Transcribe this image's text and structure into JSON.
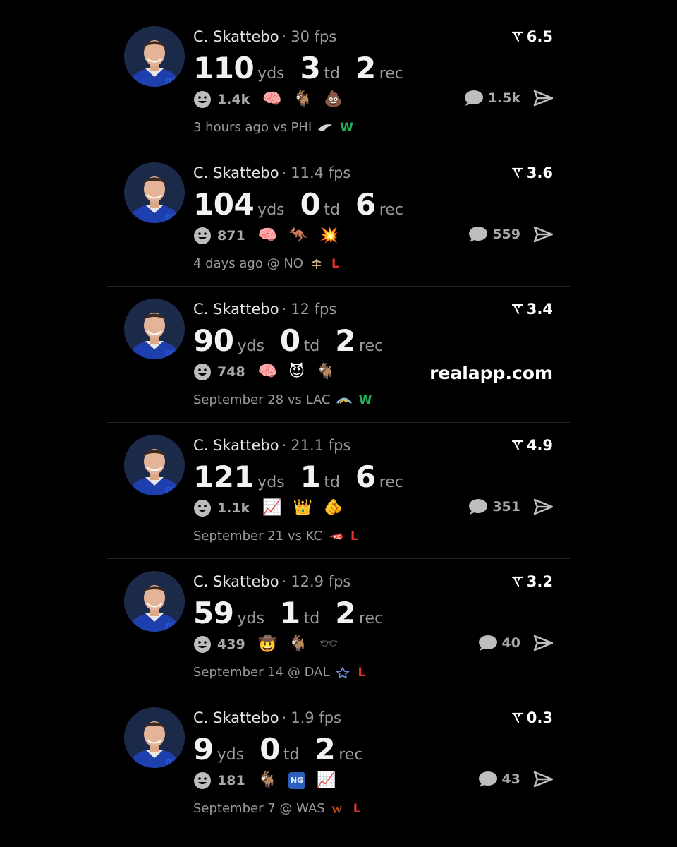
{
  "posts": [
    {
      "name": "C. Skattebo",
      "separator": "·",
      "fps": "30 fps",
      "score": "6.5",
      "yds": "110",
      "yds_unit": "yds",
      "td": "3",
      "td_unit": "td",
      "rec": "2",
      "rec_unit": "rec",
      "reaction_count": "1.4k",
      "emojis": [
        "🧠",
        "🐐",
        "💩"
      ],
      "comments": "1.5k",
      "time": "3 hours ago",
      "location": "vs PHI",
      "result": "W",
      "opponent_logo_icon": "eagles-logo-icon",
      "result_color": "#22b35a"
    },
    {
      "name": "C. Skattebo",
      "separator": "·",
      "fps": "11.4 fps",
      "score": "3.6",
      "yds": "104",
      "yds_unit": "yds",
      "td": "0",
      "td_unit": "td",
      "rec": "6",
      "rec_unit": "rec",
      "reaction_count": "871",
      "emojis": [
        "🧠",
        "🦘",
        "💥"
      ],
      "comments": "559",
      "time": "4 days ago",
      "location": "@ NO",
      "result": "L",
      "opponent_logo_icon": "saints-logo-icon",
      "result_color": "#e0312a"
    },
    {
      "name": "C. Skattebo",
      "separator": "·",
      "fps": "12 fps",
      "score": "3.4",
      "yds": "90",
      "yds_unit": "yds",
      "td": "0",
      "td_unit": "td",
      "rec": "2",
      "rec_unit": "rec",
      "reaction_count": "748",
      "emojis": [
        "🧠",
        "😈",
        "🐐"
      ],
      "website": "realapp.com",
      "time": "September 28",
      "location": "vs LAC",
      "result": "W",
      "opponent_logo_icon": "chargers-logo-icon",
      "result_color": "#22b35a"
    },
    {
      "name": "C. Skattebo",
      "separator": "·",
      "fps": "21.1 fps",
      "score": "4.9",
      "yds": "121",
      "yds_unit": "yds",
      "td": "1",
      "td_unit": "td",
      "rec": "6",
      "rec_unit": "rec",
      "reaction_count": "1.1k",
      "emojis": [
        "📈",
        "👑",
        "🫵"
      ],
      "comments": "351",
      "time": "September 21",
      "location": "vs KC",
      "result": "L",
      "opponent_logo_icon": "chiefs-logo-icon",
      "result_color": "#e0312a"
    },
    {
      "name": "C. Skattebo",
      "separator": "·",
      "fps": "12.9 fps",
      "score": "3.2",
      "yds": "59",
      "yds_unit": "yds",
      "td": "1",
      "td_unit": "td",
      "rec": "2",
      "rec_unit": "rec",
      "reaction_count": "439",
      "emojis": [
        "🤠",
        "🐐",
        "🕶️"
      ],
      "comments": "40",
      "time": "September 14",
      "location": "@ DAL",
      "result": "L",
      "opponent_logo_icon": "cowboys-logo-icon",
      "result_color": "#e0312a"
    },
    {
      "name": "C. Skattebo",
      "separator": "·",
      "fps": "1.9 fps",
      "score": "0.3",
      "yds": "9",
      "yds_unit": "yds",
      "td": "0",
      "td_unit": "td",
      "rec": "2",
      "rec_unit": "rec",
      "reaction_count": "181",
      "emojis": [
        "🐐",
        "NG",
        "📈"
      ],
      "comments": "43",
      "time": "September 7",
      "location": "@ WAS",
      "result": "L",
      "opponent_logo_icon": "commanders-logo-icon",
      "result_color": "#e0312a"
    }
  ]
}
